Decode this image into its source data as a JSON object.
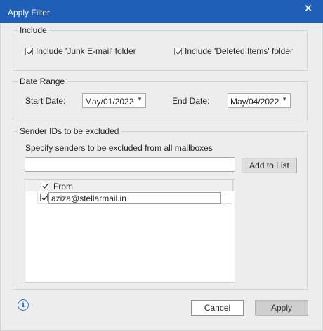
{
  "window": {
    "title": "Apply Filter",
    "close_glyph": "✕"
  },
  "include": {
    "legend": "Include",
    "junk_label": "Include 'Junk E-mail' folder",
    "junk_checked": true,
    "deleted_label": "Include 'Deleted Items' folder",
    "deleted_checked": true
  },
  "date_range": {
    "legend": "Date Range",
    "start_label": "Start Date:",
    "start_value": "May/01/2022",
    "end_label": "End Date:",
    "end_value": "May/04/2022"
  },
  "sender": {
    "legend": "Sender IDs to be excluded",
    "description": "Specify senders to be excluded from all mailboxes",
    "input_value": "",
    "add_label": "Add to List",
    "column_header": "From",
    "rows": [
      {
        "email": "aziza@stellarmail.in",
        "checked": true
      }
    ]
  },
  "footer": {
    "info_icon": "info-icon",
    "cancel_label": "Cancel",
    "apply_label": "Apply"
  },
  "colors": {
    "titlebar": "#1f5fb8",
    "dialog_bg": "#ededed",
    "info": "#2a76d2"
  }
}
